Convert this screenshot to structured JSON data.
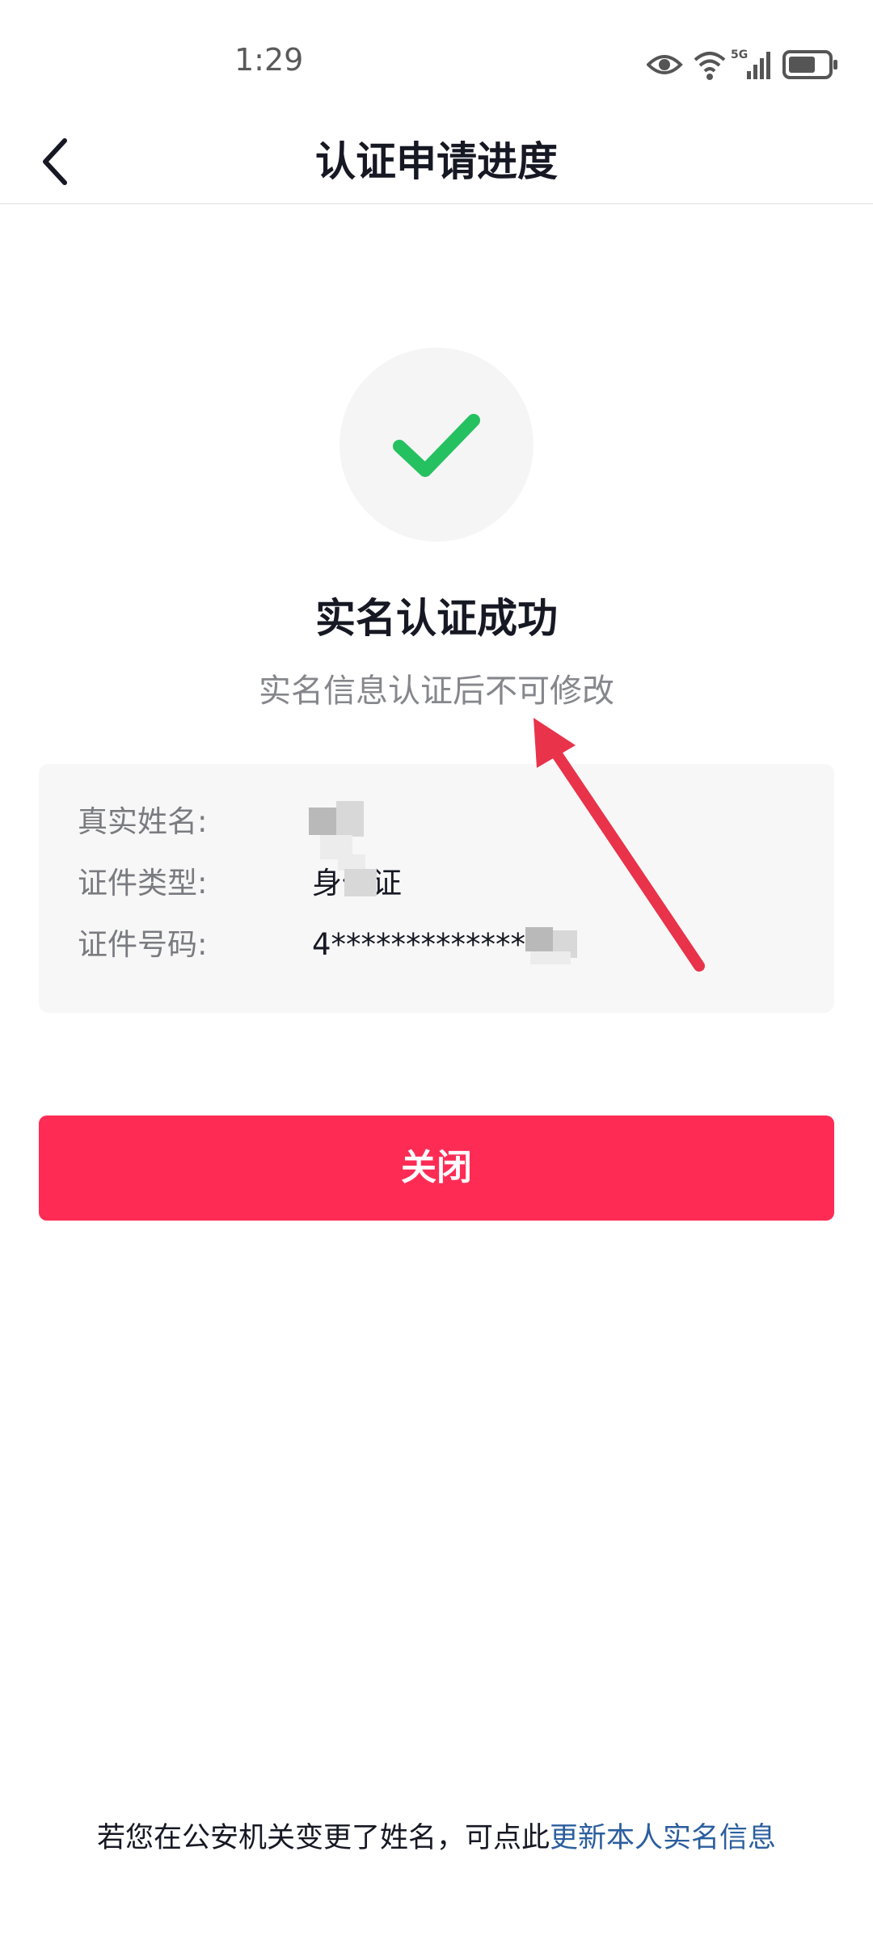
{
  "status_bar": {
    "time": "1:29",
    "icons": [
      "eye-icon",
      "wifi-icon",
      "5g-signal-icon",
      "battery-icon"
    ],
    "network_label": "5G"
  },
  "nav": {
    "title": "认证申请进度",
    "back_icon": "chevron-left-icon"
  },
  "result": {
    "icon": "check-icon",
    "icon_color": "#25c161",
    "title": "实名认证成功",
    "subtitle": "实名信息认证后不可修改"
  },
  "info": {
    "rows": [
      {
        "label": "真实姓名:",
        "value": ""
      },
      {
        "label": "证件类型:",
        "value": "身份证"
      },
      {
        "label": "证件号码:",
        "value": "4***************"
      }
    ]
  },
  "close_button": {
    "label": "关闭",
    "color": "#fe2c55"
  },
  "footer": {
    "text": "若您在公安机关变更了姓名，可点此",
    "link": "更新本人实名信息",
    "link_color": "#2b5e9e"
  },
  "annotation": {
    "arrow_color": "#e8334a"
  }
}
